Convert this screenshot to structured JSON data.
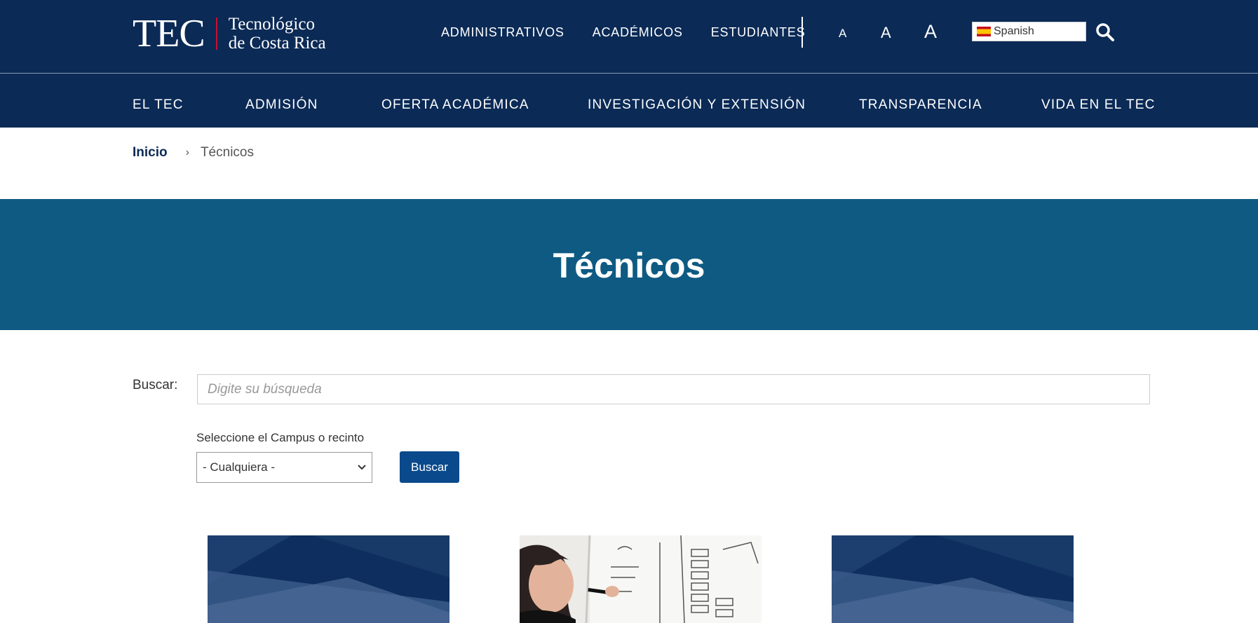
{
  "header": {
    "logo": {
      "mark": "TEC",
      "line1": "Tecnológico",
      "line2": "de Costa Rica"
    },
    "top_links": [
      "ADMINISTRATIVOS",
      "ACADÉMICOS",
      "ESTUDIANTES"
    ],
    "font_size_controls": [
      "A",
      "A",
      "A"
    ],
    "language": "Spanish"
  },
  "nav": {
    "items": [
      "EL TEC",
      "ADMISIÓN",
      "OFERTA ACADÉMICA",
      "INVESTIGACIÓN Y EXTENSIÓN",
      "TRANSPARENCIA",
      "VIDA EN EL TEC"
    ]
  },
  "breadcrumb": {
    "home": "Inicio",
    "separator": "›",
    "current": "Técnicos"
  },
  "hero": {
    "title": "Técnicos"
  },
  "form": {
    "search_label": "Buscar:",
    "search_placeholder": "Digite su búsqueda",
    "search_value": "",
    "campus_label": "Seleccione el Campus o recinto",
    "campus_selected": "- Cualquiera -",
    "submit_label": "Buscar"
  },
  "cards": [
    {
      "image": "geometric-blue-placeholder"
    },
    {
      "image": "person-writing-on-whiteboard"
    },
    {
      "image": "geometric-blue-placeholder"
    }
  ],
  "colors": {
    "navy": "#0b2a56",
    "hero_teal": "#0f5a82",
    "button_blue": "#0a4a8c",
    "logo_accent": "#c8102e"
  }
}
